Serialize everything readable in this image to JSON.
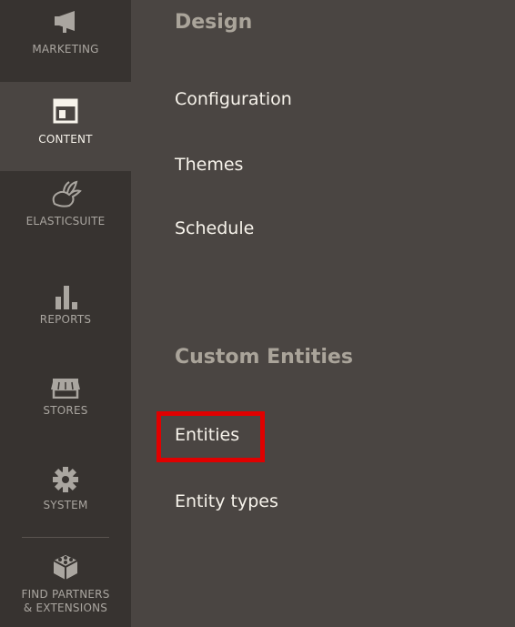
{
  "sidebar": {
    "items": [
      {
        "label": "MARKETING",
        "icon": "megaphone-icon"
      },
      {
        "label": "CONTENT",
        "icon": "layout-icon",
        "active": true
      },
      {
        "label": "ELASTICSUITE",
        "icon": "rabbit-icon"
      },
      {
        "label": "REPORTS",
        "icon": "bar-chart-icon"
      },
      {
        "label": "STORES",
        "icon": "storefront-icon"
      },
      {
        "label": "SYSTEM",
        "icon": "gear-icon"
      },
      {
        "label": "FIND PARTNERS\n& EXTENSIONS",
        "icon": "cubes-icon"
      }
    ]
  },
  "panel": {
    "design": {
      "title": "Design",
      "links": [
        "Configuration",
        "Themes",
        "Schedule"
      ]
    },
    "custom_entities": {
      "title": "Custom Entities",
      "links": [
        "Entities",
        "Entity types"
      ]
    }
  },
  "colors": {
    "sidebar_bg": "#373330",
    "active_bg": "#4a4542",
    "panel_bg": "#4a4542",
    "highlight": "#e00000",
    "link_text": "#f7f3eb",
    "section_title": "#aaa49a"
  }
}
